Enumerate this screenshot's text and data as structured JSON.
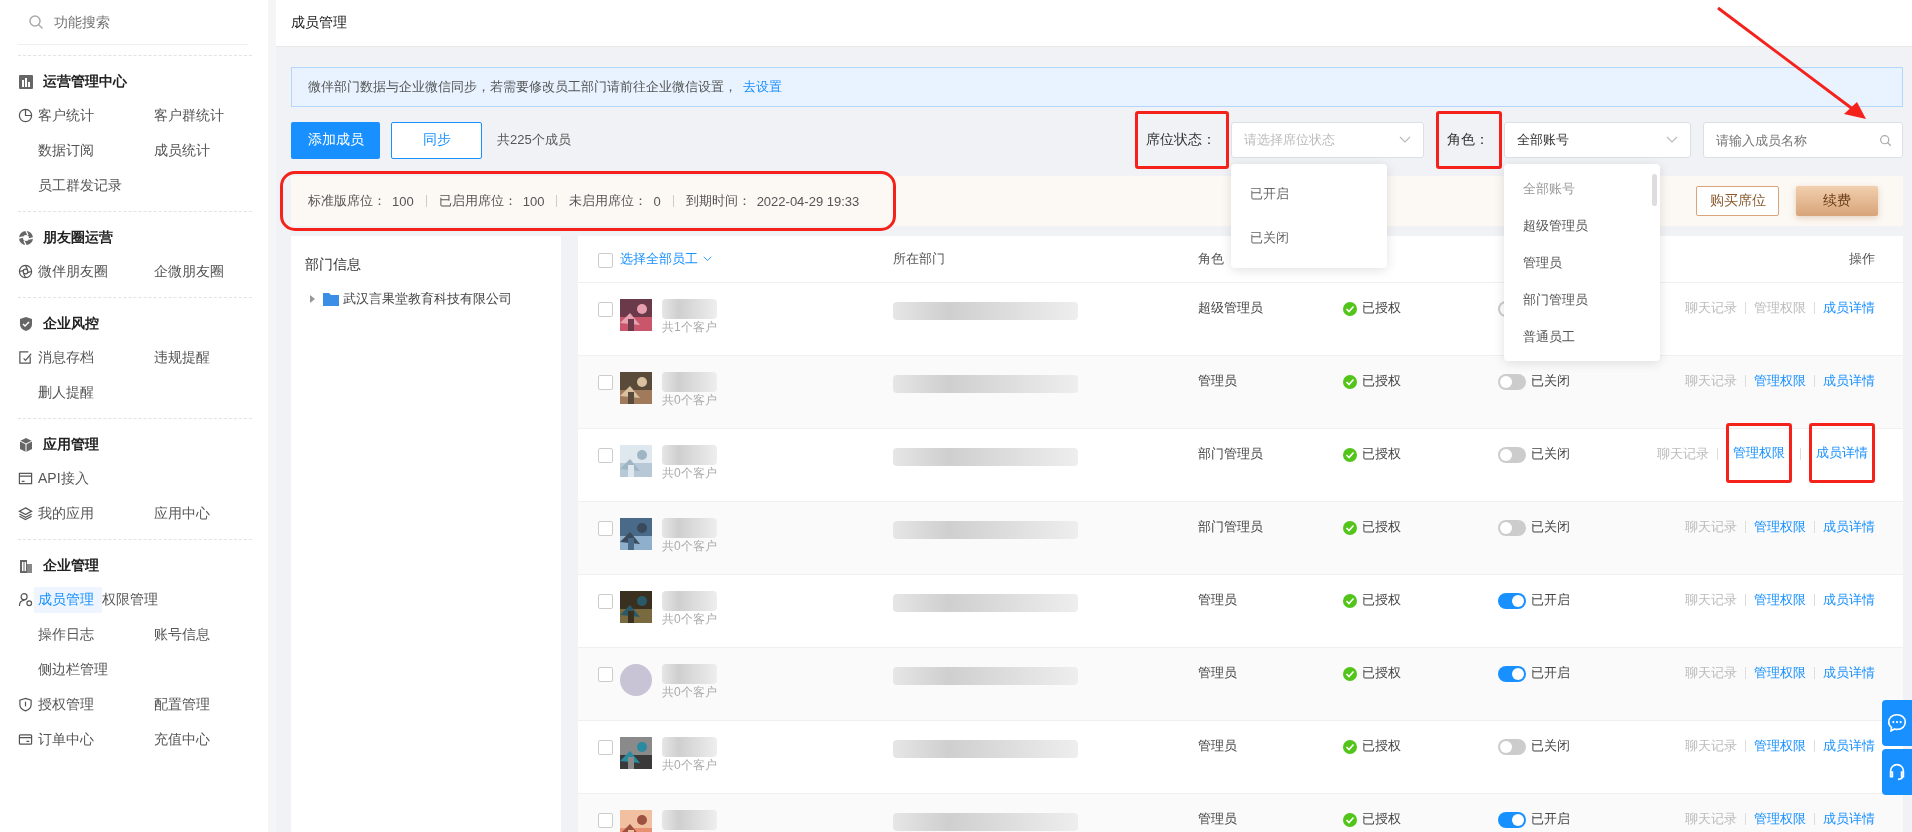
{
  "sidebar": {
    "search": {
      "placeholder": "功能搜索"
    },
    "groups": [
      {
        "title": "运营管理中心",
        "rows": [
          {
            "has_icon": true,
            "items": [
              {
                "label": "客户统计",
                "selected": false
              },
              {
                "label": "客户群统计",
                "selected": false
              }
            ]
          },
          {
            "has_icon": false,
            "items": [
              {
                "label": "数据订阅",
                "selected": false
              },
              {
                "label": "成员统计",
                "selected": false
              }
            ]
          },
          {
            "has_icon": false,
            "items": [
              {
                "label": "员工群发记录",
                "selected": false
              }
            ]
          }
        ]
      },
      {
        "title": "朋友圈运营",
        "rows": [
          {
            "has_icon": true,
            "items": [
              {
                "label": "微伴朋友圈",
                "selected": false
              },
              {
                "label": "企微朋友圈",
                "selected": false
              }
            ]
          }
        ]
      },
      {
        "title": "企业风控",
        "rows": [
          {
            "has_icon": true,
            "items": [
              {
                "label": "消息存档",
                "selected": false
              },
              {
                "label": "违规提醒",
                "selected": false
              }
            ]
          },
          {
            "has_icon": false,
            "items": [
              {
                "label": "删人提醒",
                "selected": false
              }
            ]
          }
        ]
      },
      {
        "title": "应用管理",
        "rows": [
          {
            "has_icon": true,
            "items": [
              {
                "label": "API接入",
                "selected": false
              }
            ]
          },
          {
            "has_icon": true,
            "items": [
              {
                "label": "我的应用",
                "selected": false
              },
              {
                "label": "应用中心",
                "selected": false
              }
            ]
          }
        ]
      },
      {
        "title": "企业管理",
        "rows": [
          {
            "has_icon": true,
            "items": [
              {
                "label": "成员管理",
                "selected": true
              },
              {
                "label": "权限管理",
                "selected": false
              }
            ]
          },
          {
            "has_icon": false,
            "items": [
              {
                "label": "操作日志",
                "selected": false
              },
              {
                "label": "账号信息",
                "selected": false
              }
            ]
          },
          {
            "has_icon": false,
            "items": [
              {
                "label": "侧边栏管理",
                "selected": false
              }
            ]
          },
          {
            "has_icon": true,
            "items": [
              {
                "label": "授权管理",
                "selected": false
              },
              {
                "label": "配置管理",
                "selected": false
              }
            ]
          },
          {
            "has_icon": true,
            "items": [
              {
                "label": "订单中心",
                "selected": false
              },
              {
                "label": "充值中心",
                "selected": false
              }
            ]
          }
        ]
      }
    ]
  },
  "header": {
    "title": "成员管理"
  },
  "notice": {
    "text": "微伴部门数据与企业微信同步，若需要修改员工部门请前往企业微信设置，",
    "link": "去设置"
  },
  "toolbar": {
    "add_button": "添加成员",
    "sync_button": "同步",
    "member_count": "共225个成员",
    "seat_filter": {
      "label": "席位状态：",
      "highlighted": true,
      "placeholder": "请选择席位状态",
      "open": true,
      "options": [
        {
          "label": "已开启",
          "selected": false
        },
        {
          "label": "已关闭",
          "selected": false
        }
      ]
    },
    "role_filter": {
      "label": "角色：",
      "highlighted": true,
      "value": "全部账号",
      "open": true,
      "options": [
        {
          "label": "全部账号",
          "selected": true
        },
        {
          "label": "超级管理员",
          "selected": false
        },
        {
          "label": "管理员",
          "selected": false
        },
        {
          "label": "部门管理员",
          "selected": false
        },
        {
          "label": "普通员工",
          "selected": false
        }
      ]
    },
    "search": {
      "placeholder": "请输入成员名称"
    }
  },
  "seat_summary": {
    "highlighted": true,
    "items": [
      {
        "label": "标准版席位：",
        "value": "100"
      },
      {
        "label": "已启用席位：",
        "value": "100"
      },
      {
        "label": "未启用席位：",
        "value": "0"
      },
      {
        "label": "到期时间：",
        "value": "2022-04-29 19:33"
      }
    ],
    "buy_button": "购买席位",
    "renew_button": "续费"
  },
  "departments": {
    "title": "部门信息",
    "tree": [
      {
        "label": "武汉言果堂教育科技有限公司",
        "expanded": false
      }
    ]
  },
  "table": {
    "select_all": {
      "label": "选择全部员工",
      "checked": false
    },
    "header": {
      "department": "所在部门",
      "role": "角色",
      "actions": "操作"
    },
    "rows": [
      {
        "checked": false,
        "avatar": {
          "kind": "picture"
        },
        "customers": "共1个客户",
        "role": "超级管理员",
        "auth": "已授权",
        "seat_on": false,
        "actions": [
          {
            "label": "聊天记录",
            "enabled": false,
            "highlighted": false
          },
          {
            "label": "管理权限",
            "enabled": false,
            "highlighted": false
          },
          {
            "label": "成员详情",
            "enabled": true,
            "highlighted": false
          }
        ]
      },
      {
        "checked": false,
        "avatar": {
          "kind": "picture"
        },
        "customers": "共0个客户",
        "role": "管理员",
        "auth": "已授权",
        "seat_on": false,
        "seat_label": "已关闭",
        "actions": [
          {
            "label": "聊天记录",
            "enabled": false,
            "highlighted": false
          },
          {
            "label": "管理权限",
            "enabled": true,
            "highlighted": false
          },
          {
            "label": "成员详情",
            "enabled": true,
            "highlighted": false
          }
        ]
      },
      {
        "checked": false,
        "avatar": {
          "kind": "picture"
        },
        "customers": "共0个客户",
        "role": "部门管理员",
        "auth": "已授权",
        "seat_on": false,
        "seat_label": "已关闭",
        "actions": [
          {
            "label": "聊天记录",
            "enabled": false,
            "highlighted": false
          },
          {
            "label": "管理权限",
            "enabled": true,
            "highlighted": true
          },
          {
            "label": "成员详情",
            "enabled": true,
            "highlighted": true
          }
        ]
      },
      {
        "checked": false,
        "avatar": {
          "kind": "picture"
        },
        "customers": "共0个客户",
        "role": "部门管理员",
        "auth": "已授权",
        "seat_on": false,
        "seat_label": "已关闭",
        "actions": [
          {
            "label": "聊天记录",
            "enabled": false,
            "highlighted": false
          },
          {
            "label": "管理权限",
            "enabled": true,
            "highlighted": false
          },
          {
            "label": "成员详情",
            "enabled": true,
            "highlighted": false
          }
        ]
      },
      {
        "checked": false,
        "avatar": {
          "kind": "picture"
        },
        "customers": "共0个客户",
        "role": "管理员",
        "auth": "已授权",
        "seat_on": true,
        "seat_label": "已开启",
        "actions": [
          {
            "label": "聊天记录",
            "enabled": false,
            "highlighted": false
          },
          {
            "label": "管理权限",
            "enabled": true,
            "highlighted": false
          },
          {
            "label": "成员详情",
            "enabled": true,
            "highlighted": false
          }
        ]
      },
      {
        "checked": false,
        "avatar": {
          "kind": "figure"
        },
        "customers": "共0个客户",
        "role": "管理员",
        "auth": "已授权",
        "seat_on": true,
        "seat_label": "已开启",
        "actions": [
          {
            "label": "聊天记录",
            "enabled": false,
            "highlighted": false
          },
          {
            "label": "管理权限",
            "enabled": true,
            "highlighted": false
          },
          {
            "label": "成员详情",
            "enabled": true,
            "highlighted": false
          }
        ]
      },
      {
        "checked": false,
        "avatar": {
          "kind": "picture"
        },
        "customers": "共0个客户",
        "role": "管理员",
        "auth": "已授权",
        "seat_on": false,
        "seat_label": "已关闭",
        "actions": [
          {
            "label": "聊天记录",
            "enabled": false,
            "highlighted": false
          },
          {
            "label": "管理权限",
            "enabled": true,
            "highlighted": false
          },
          {
            "label": "成员详情",
            "enabled": true,
            "highlighted": false
          }
        ]
      },
      {
        "checked": false,
        "avatar": {
          "kind": "picture"
        },
        "role": "管理员",
        "auth": "已授权",
        "seat_on": true,
        "seat_label": "已开启",
        "actions": [
          {
            "label": "聊天记录",
            "enabled": false,
            "highlighted": false
          },
          {
            "label": "管理权限",
            "enabled": true,
            "highlighted": false
          },
          {
            "label": "成员详情",
            "enabled": true,
            "highlighted": false
          }
        ]
      }
    ]
  },
  "annotation_arrow": true
}
